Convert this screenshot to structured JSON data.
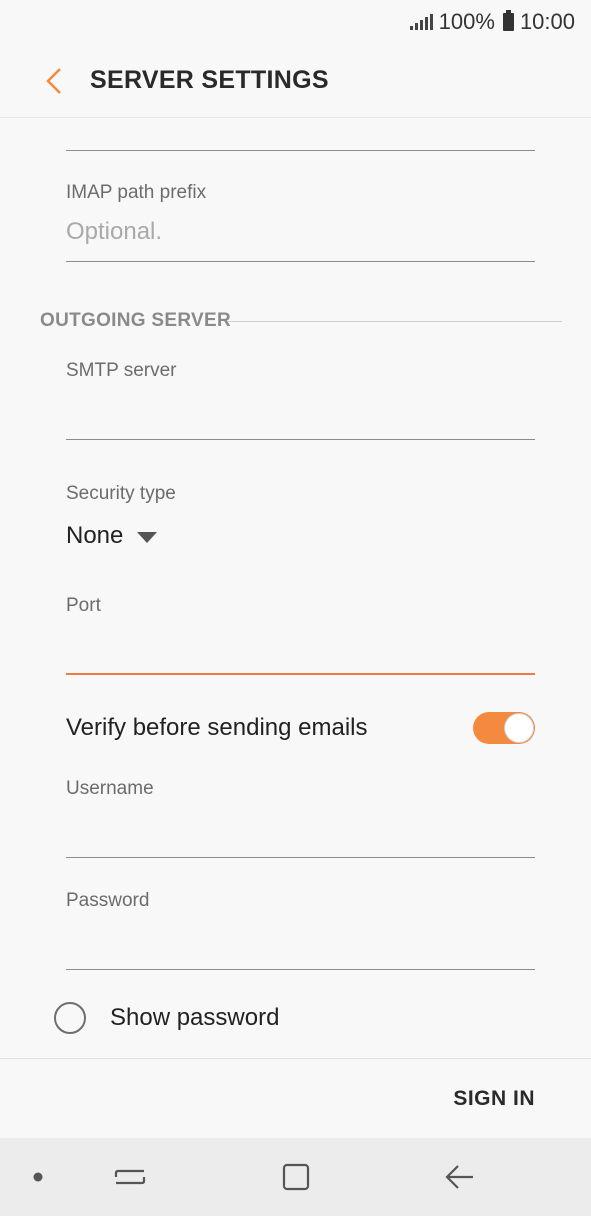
{
  "status_bar": {
    "battery": "100%",
    "time": "10:00"
  },
  "header": {
    "title": "SERVER SETTINGS"
  },
  "incoming": {
    "imap_path_prefix": {
      "label": "IMAP path prefix",
      "placeholder": "Optional."
    }
  },
  "outgoing": {
    "section_title": "OUTGOING SERVER",
    "smtp_server": {
      "label": "SMTP server",
      "value": ""
    },
    "security_type": {
      "label": "Security type",
      "value": "None"
    },
    "port": {
      "label": "Port",
      "value": ""
    },
    "verify": {
      "label": "Verify before sending emails",
      "enabled": true
    },
    "username": {
      "label": "Username",
      "value": ""
    },
    "password": {
      "label": "Password",
      "value": ""
    },
    "show_password": {
      "label": "Show password",
      "checked": false
    }
  },
  "footer": {
    "sign_in": "SIGN IN"
  },
  "colors": {
    "accent": "#f48a3f",
    "background": "#f8f8f8"
  }
}
